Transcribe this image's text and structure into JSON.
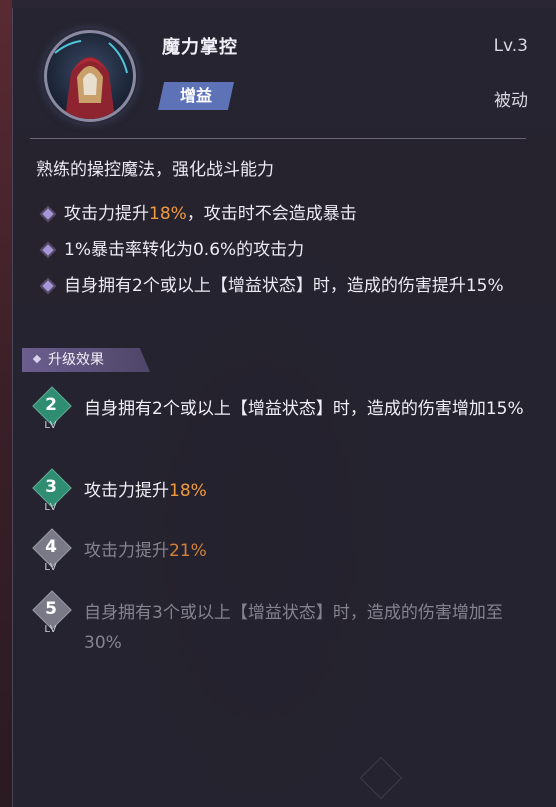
{
  "skill": {
    "name": "魔力掌控",
    "level": "Lv.3",
    "tag": "增益",
    "type": "被动",
    "description": "熟练的操控魔法，强化战斗能力",
    "effects": [
      {
        "before": "攻击力提升",
        "highlight": "18%",
        "after": "，攻击时不会造成暴击"
      },
      {
        "before": "1%暴击率转化为0.6%的攻击力",
        "highlight": "",
        "after": ""
      },
      {
        "before": "自身拥有2个或以上【增益状态】时，造成的伤害提升15%",
        "highlight": "",
        "after": ""
      }
    ]
  },
  "upgrade": {
    "label": "升级效果",
    "levels": [
      {
        "num": "2",
        "lv": "LV",
        "active": true,
        "before": "自身拥有2个或以上【增益状态】时，造成的伤害增加15%",
        "highlight": ""
      },
      {
        "num": "3",
        "lv": "LV",
        "active": true,
        "before": "攻击力提升",
        "highlight": "18%"
      },
      {
        "num": "4",
        "lv": "LV",
        "active": false,
        "before": "攻击力提升",
        "highlight": "21%"
      },
      {
        "num": "5",
        "lv": "LV",
        "active": false,
        "before": "自身拥有3个或以上【增益状态】时，造成的伤害增加至30%",
        "highlight": ""
      }
    ]
  },
  "colors": {
    "highlight": "#f09a3e",
    "active_gem": "#2f8e72",
    "inactive_gem": "#7a7988",
    "buff_badge": "#5e72b8"
  }
}
